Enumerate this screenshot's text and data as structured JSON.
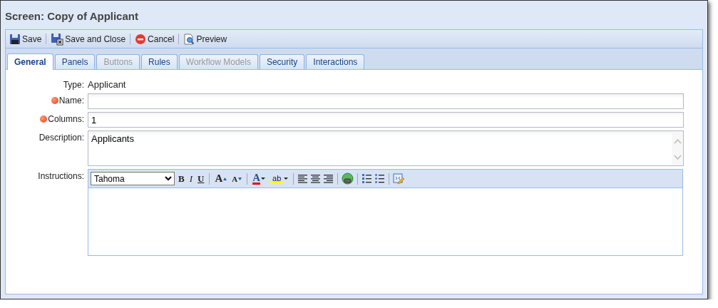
{
  "window": {
    "title": "Screen: Copy of Applicant"
  },
  "toolbar": [
    {
      "label": "Save",
      "kind": "save"
    },
    {
      "label": "Save and Close",
      "kind": "save-close"
    },
    {
      "label": "Cancel",
      "kind": "cancel"
    },
    {
      "label": "Preview",
      "kind": "preview"
    }
  ],
  "tabs": [
    {
      "label": "General",
      "selected": true,
      "disabled": false
    },
    {
      "label": "Panels",
      "selected": false,
      "disabled": false
    },
    {
      "label": "Buttons",
      "selected": false,
      "disabled": true
    },
    {
      "label": "Rules",
      "selected": false,
      "disabled": false
    },
    {
      "label": "Workflow Models",
      "selected": false,
      "disabled": true
    },
    {
      "label": "Security",
      "selected": false,
      "disabled": false
    },
    {
      "label": "Interactions",
      "selected": false,
      "disabled": false
    }
  ],
  "fields": [
    {
      "kind": "static",
      "label": "Type:",
      "required": false,
      "value": "Applicant"
    },
    {
      "kind": "input",
      "label": "Name:",
      "required": true
    },
    {
      "kind": "input",
      "label": "Columns:",
      "required": true,
      "value": "1"
    },
    {
      "kind": "textarea",
      "label": "Description:",
      "required": false,
      "value": "Applicants"
    },
    {
      "kind": "editor",
      "label": "Instructions:",
      "required": false,
      "font": "Tahoma"
    }
  ],
  "editor_tools": [
    {
      "kind": "bold",
      "label": "B"
    },
    {
      "kind": "italic",
      "label": "I"
    },
    {
      "kind": "underline",
      "label": "U"
    },
    {
      "kind": "sep"
    },
    {
      "kind": "grow",
      "label": "A"
    },
    {
      "kind": "shrink",
      "label": "A"
    },
    {
      "kind": "sep"
    },
    {
      "kind": "forecolor",
      "label": "A"
    },
    {
      "kind": "highlight",
      "label": "ab"
    },
    {
      "kind": "sep"
    },
    {
      "kind": "align-left"
    },
    {
      "kind": "align-center"
    },
    {
      "kind": "align-right"
    },
    {
      "kind": "sep"
    },
    {
      "kind": "link"
    },
    {
      "kind": "sep"
    },
    {
      "kind": "ol"
    },
    {
      "kind": "ul"
    },
    {
      "kind": "sep"
    },
    {
      "kind": "source"
    }
  ]
}
